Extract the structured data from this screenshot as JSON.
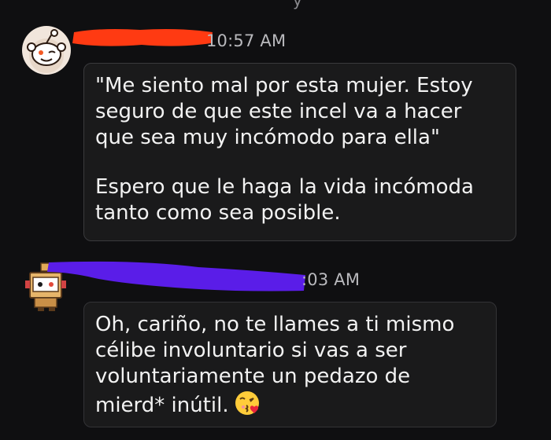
{
  "top_fragment": "y",
  "messages": [
    {
      "timestamp": "10:57 AM",
      "avatar_icon": "snoo-avatar-icon",
      "redaction_color": "#ff3a12",
      "lines_para1": [
        "\"Me siento mal por esta mujer. Estoy",
        "seguro de que este incel va a hacer",
        "que sea muy incómodo para ella\""
      ],
      "lines_para2": [
        "Espero que le haga la vida incómoda",
        "tanto como sea posible."
      ]
    },
    {
      "timestamp": ":03 AM",
      "avatar_icon": "box-robot-avatar-icon",
      "redaction_color": "#5a1de8",
      "lines": [
        "Oh, cariño, no te llames a ti mismo",
        "célibe involuntario si vas a ser",
        "voluntariamente un pedazo de",
        "mierd* inútil."
      ],
      "emoji": "kissing-face-icon"
    }
  ],
  "colors": {
    "background": "#0f0f11",
    "bubble": "#1a1a1b",
    "bubble_border": "#3a3a3d",
    "text": "#f2f2f2",
    "timestamp": "#b9b9bd"
  }
}
